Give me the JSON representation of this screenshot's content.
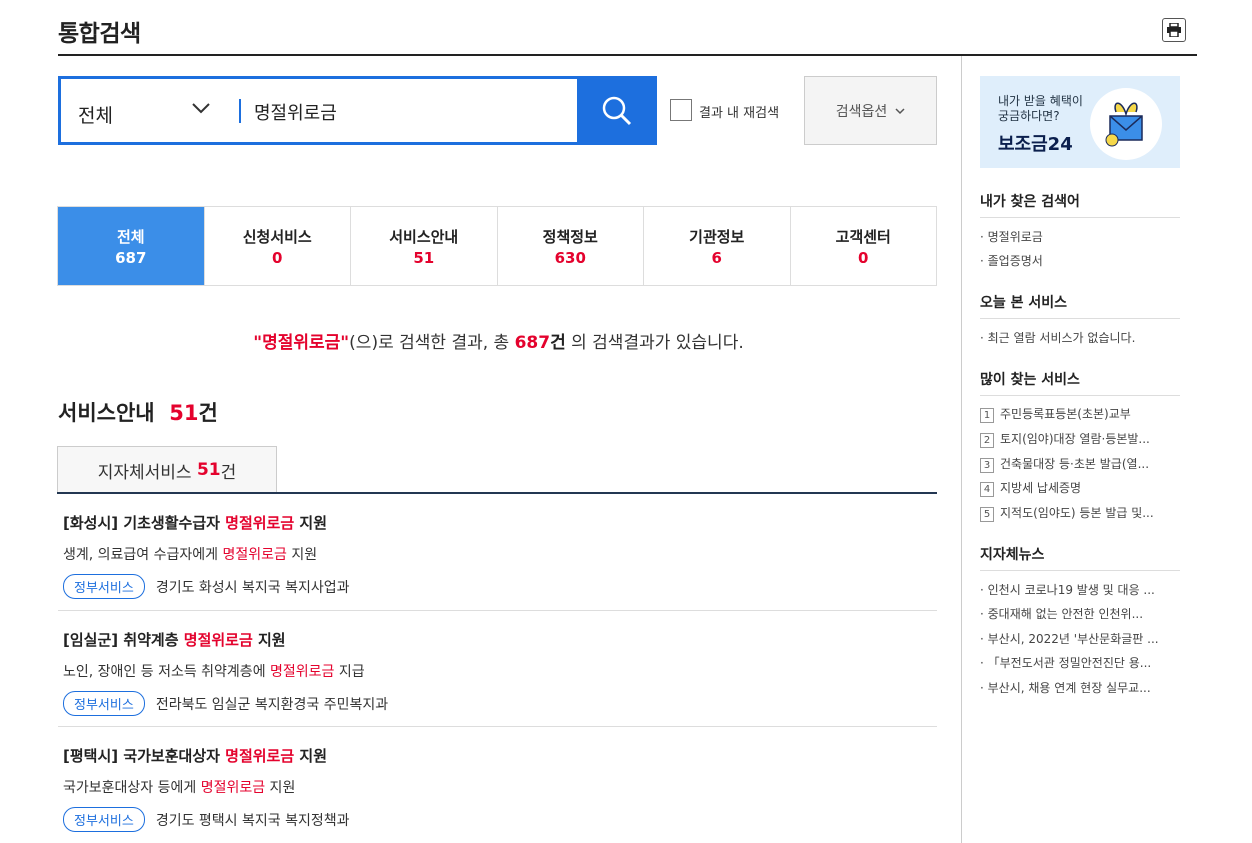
{
  "page": {
    "title": "통합검색"
  },
  "search": {
    "category": "전체",
    "query": "명절위로금",
    "recheck_label": "결과 내 재검색",
    "options_label": "검색옵션"
  },
  "tabs": [
    {
      "label": "전체",
      "count": "687",
      "active": true
    },
    {
      "label": "신청서비스",
      "count": "0"
    },
    {
      "label": "서비스안내",
      "count": "51"
    },
    {
      "label": "정책정보",
      "count": "630"
    },
    {
      "label": "기관정보",
      "count": "6"
    },
    {
      "label": "고객센터",
      "count": "0"
    }
  ],
  "summary": {
    "keyword": "\"명절위로금\"",
    "text1": "(으)로 검색한 결과, 총 ",
    "count": "687",
    "unit": "건",
    "text2": " 의 검색결과가 있습니다."
  },
  "section": {
    "title": "서비스안내",
    "count": "51",
    "unit": "건"
  },
  "subtab": {
    "label": "지자체서비스",
    "count": "51",
    "unit": "건"
  },
  "results": [
    {
      "title_pre": "[화성시] 기초생활수급자 ",
      "title_hl": "명절위로금",
      "title_post": " 지원",
      "desc_pre": "생계, 의료급여 수급자에게 ",
      "desc_hl": "명절위로금",
      "desc_post": " 지원",
      "badge": "정부서비스",
      "org": "경기도 화성시 복지국 복지사업과"
    },
    {
      "title_pre": "[임실군] 취약계층 ",
      "title_hl": "명절위로금",
      "title_post": " 지원",
      "desc_pre": "노인, 장애인 등 저소득 취약계층에 ",
      "desc_hl": "명절위로금",
      "desc_post": " 지급",
      "badge": "정부서비스",
      "org": "전라북도 임실군 복지환경국 주민복지과"
    },
    {
      "title_pre": "[평택시] 국가보훈대상자 ",
      "title_hl": "명절위로금",
      "title_post": " 지원",
      "desc_pre": "국가보훈대상자 등에게 ",
      "desc_hl": "명절위로금",
      "desc_post": " 지원",
      "badge": "정부서비스",
      "org": "경기도 평택시 복지국 복지정책과"
    }
  ],
  "banner": {
    "line1": "내가 받을 혜택이",
    "line2": "궁금하다면?",
    "brand": "보조금24"
  },
  "sidebar": {
    "my_searches": {
      "title": "내가 찾은 검색어",
      "items": [
        "명절위로금",
        "졸업증명서"
      ]
    },
    "today_viewed": {
      "title": "오늘 본 서비스",
      "items": [
        "최근 열람 서비스가 없습니다."
      ]
    },
    "popular": {
      "title": "많이 찾는 서비스",
      "items": [
        {
          "rank": "1",
          "label": "주민등록표등본(초본)교부"
        },
        {
          "rank": "2",
          "label": "토지(임야)대장 열람·등본발..."
        },
        {
          "rank": "3",
          "label": "건축물대장 등·초본 발급(열..."
        },
        {
          "rank": "4",
          "label": "지방세 납세증명"
        },
        {
          "rank": "5",
          "label": "지적도(임야도) 등본 발급 및..."
        }
      ]
    },
    "news": {
      "title": "지자체뉴스",
      "items": [
        "인천시 코로나19 발생 및 대응 ...",
        "중대재해 없는 안전한 인천위...",
        "부산시, 2022년 '부산문화글판 ...",
        "「부전도서관 정밀안전진단 용...",
        "부산시, 채용 연계 현장 실무교..."
      ]
    }
  }
}
